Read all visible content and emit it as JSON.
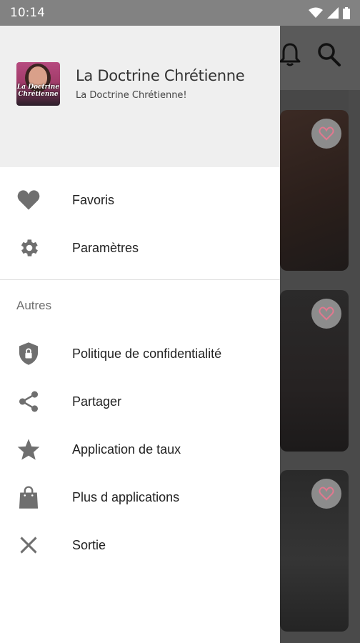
{
  "status_bar": {
    "time": "10:14",
    "icons": [
      "wifi-icon",
      "signal-icon",
      "battery-icon"
    ]
  },
  "colors": {
    "drawer_header": "#efefef",
    "icon_gray": "#6f6f6f",
    "scrim": "#5e5e5e",
    "favorite_accent": "#e2788f"
  },
  "toolbar": {
    "icons": [
      "notifications-icon",
      "search-icon"
    ]
  },
  "drawer": {
    "header": {
      "title": "La Doctrine Chrétienne",
      "subtitle": "La Doctrine Chrétienne!",
      "logo_text": "La Doctrine Chrétienne"
    },
    "primary_items": [
      {
        "label": "Favoris",
        "icon": "heart-icon"
      },
      {
        "label": "Paramètres",
        "icon": "gear-icon"
      }
    ],
    "section_title": "Autres",
    "other_items": [
      {
        "label": "Politique de confidentialité",
        "icon": "shield-lock-icon"
      },
      {
        "label": "Partager",
        "icon": "share-icon"
      },
      {
        "label": "Application de taux",
        "icon": "star-icon"
      },
      {
        "label": "Plus d applications",
        "icon": "shopping-bag-icon"
      },
      {
        "label": "Sortie",
        "icon": "close-icon"
      }
    ]
  }
}
